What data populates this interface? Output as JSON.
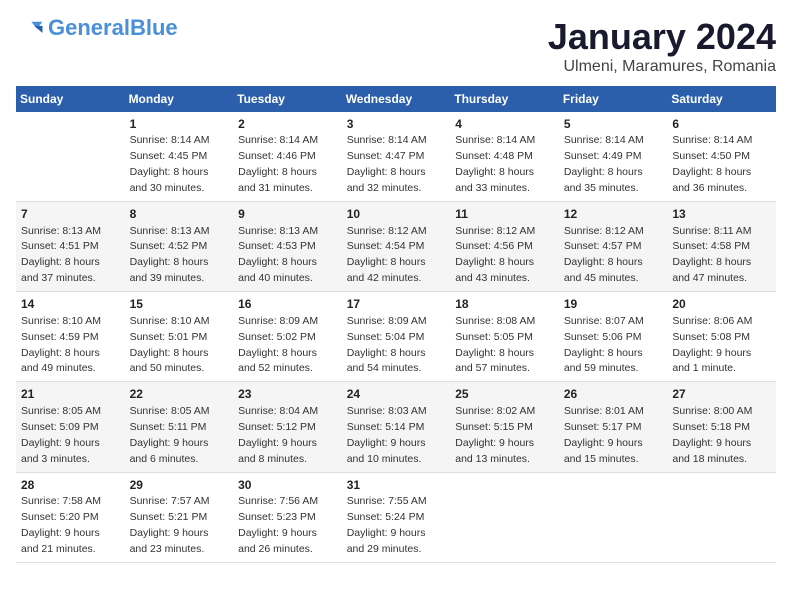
{
  "header": {
    "logo_general": "General",
    "logo_blue": "Blue",
    "month": "January 2024",
    "location": "Ulmeni, Maramures, Romania"
  },
  "days_of_week": [
    "Sunday",
    "Monday",
    "Tuesday",
    "Wednesday",
    "Thursday",
    "Friday",
    "Saturday"
  ],
  "weeks": [
    [
      {
        "day": "",
        "info": ""
      },
      {
        "day": "1",
        "info": "Sunrise: 8:14 AM\nSunset: 4:45 PM\nDaylight: 8 hours\nand 30 minutes."
      },
      {
        "day": "2",
        "info": "Sunrise: 8:14 AM\nSunset: 4:46 PM\nDaylight: 8 hours\nand 31 minutes."
      },
      {
        "day": "3",
        "info": "Sunrise: 8:14 AM\nSunset: 4:47 PM\nDaylight: 8 hours\nand 32 minutes."
      },
      {
        "day": "4",
        "info": "Sunrise: 8:14 AM\nSunset: 4:48 PM\nDaylight: 8 hours\nand 33 minutes."
      },
      {
        "day": "5",
        "info": "Sunrise: 8:14 AM\nSunset: 4:49 PM\nDaylight: 8 hours\nand 35 minutes."
      },
      {
        "day": "6",
        "info": "Sunrise: 8:14 AM\nSunset: 4:50 PM\nDaylight: 8 hours\nand 36 minutes."
      }
    ],
    [
      {
        "day": "7",
        "info": "Sunrise: 8:13 AM\nSunset: 4:51 PM\nDaylight: 8 hours\nand 37 minutes."
      },
      {
        "day": "8",
        "info": "Sunrise: 8:13 AM\nSunset: 4:52 PM\nDaylight: 8 hours\nand 39 minutes."
      },
      {
        "day": "9",
        "info": "Sunrise: 8:13 AM\nSunset: 4:53 PM\nDaylight: 8 hours\nand 40 minutes."
      },
      {
        "day": "10",
        "info": "Sunrise: 8:12 AM\nSunset: 4:54 PM\nDaylight: 8 hours\nand 42 minutes."
      },
      {
        "day": "11",
        "info": "Sunrise: 8:12 AM\nSunset: 4:56 PM\nDaylight: 8 hours\nand 43 minutes."
      },
      {
        "day": "12",
        "info": "Sunrise: 8:12 AM\nSunset: 4:57 PM\nDaylight: 8 hours\nand 45 minutes."
      },
      {
        "day": "13",
        "info": "Sunrise: 8:11 AM\nSunset: 4:58 PM\nDaylight: 8 hours\nand 47 minutes."
      }
    ],
    [
      {
        "day": "14",
        "info": "Sunrise: 8:10 AM\nSunset: 4:59 PM\nDaylight: 8 hours\nand 49 minutes."
      },
      {
        "day": "15",
        "info": "Sunrise: 8:10 AM\nSunset: 5:01 PM\nDaylight: 8 hours\nand 50 minutes."
      },
      {
        "day": "16",
        "info": "Sunrise: 8:09 AM\nSunset: 5:02 PM\nDaylight: 8 hours\nand 52 minutes."
      },
      {
        "day": "17",
        "info": "Sunrise: 8:09 AM\nSunset: 5:04 PM\nDaylight: 8 hours\nand 54 minutes."
      },
      {
        "day": "18",
        "info": "Sunrise: 8:08 AM\nSunset: 5:05 PM\nDaylight: 8 hours\nand 57 minutes."
      },
      {
        "day": "19",
        "info": "Sunrise: 8:07 AM\nSunset: 5:06 PM\nDaylight: 8 hours\nand 59 minutes."
      },
      {
        "day": "20",
        "info": "Sunrise: 8:06 AM\nSunset: 5:08 PM\nDaylight: 9 hours\nand 1 minute."
      }
    ],
    [
      {
        "day": "21",
        "info": "Sunrise: 8:05 AM\nSunset: 5:09 PM\nDaylight: 9 hours\nand 3 minutes."
      },
      {
        "day": "22",
        "info": "Sunrise: 8:05 AM\nSunset: 5:11 PM\nDaylight: 9 hours\nand 6 minutes."
      },
      {
        "day": "23",
        "info": "Sunrise: 8:04 AM\nSunset: 5:12 PM\nDaylight: 9 hours\nand 8 minutes."
      },
      {
        "day": "24",
        "info": "Sunrise: 8:03 AM\nSunset: 5:14 PM\nDaylight: 9 hours\nand 10 minutes."
      },
      {
        "day": "25",
        "info": "Sunrise: 8:02 AM\nSunset: 5:15 PM\nDaylight: 9 hours\nand 13 minutes."
      },
      {
        "day": "26",
        "info": "Sunrise: 8:01 AM\nSunset: 5:17 PM\nDaylight: 9 hours\nand 15 minutes."
      },
      {
        "day": "27",
        "info": "Sunrise: 8:00 AM\nSunset: 5:18 PM\nDaylight: 9 hours\nand 18 minutes."
      }
    ],
    [
      {
        "day": "28",
        "info": "Sunrise: 7:58 AM\nSunset: 5:20 PM\nDaylight: 9 hours\nand 21 minutes."
      },
      {
        "day": "29",
        "info": "Sunrise: 7:57 AM\nSunset: 5:21 PM\nDaylight: 9 hours\nand 23 minutes."
      },
      {
        "day": "30",
        "info": "Sunrise: 7:56 AM\nSunset: 5:23 PM\nDaylight: 9 hours\nand 26 minutes."
      },
      {
        "day": "31",
        "info": "Sunrise: 7:55 AM\nSunset: 5:24 PM\nDaylight: 9 hours\nand 29 minutes."
      },
      {
        "day": "",
        "info": ""
      },
      {
        "day": "",
        "info": ""
      },
      {
        "day": "",
        "info": ""
      }
    ]
  ]
}
